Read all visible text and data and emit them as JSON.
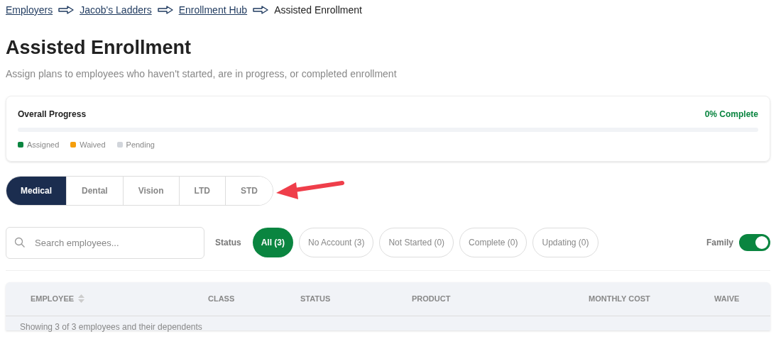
{
  "breadcrumbs": [
    {
      "label": "Employers",
      "link": true
    },
    {
      "label": "Jacob's Ladders",
      "link": true
    },
    {
      "label": "Enrollment Hub",
      "link": true
    },
    {
      "label": "Assisted Enrollment",
      "link": false
    }
  ],
  "title": "Assisted Enrollment",
  "subtitle": "Assign plans to employees who haven't started, are in progress, or completed enrollment",
  "progress": {
    "title": "Overall Progress",
    "reading": "0% Complete",
    "level": 0,
    "legend": [
      {
        "label": "Assigned",
        "color": "#0a8540"
      },
      {
        "label": "Waived",
        "color": "#f59e0b"
      },
      {
        "label": "Pending",
        "color": "#d1d5db"
      }
    ]
  },
  "tabs": [
    {
      "label": "Medical",
      "selected": true
    },
    {
      "label": "Dental",
      "selected": false
    },
    {
      "label": "Vision",
      "selected": false
    },
    {
      "label": "LTD",
      "selected": false
    },
    {
      "label": "STD",
      "selected": false
    }
  ],
  "search": {
    "placeholder": "Search employees..."
  },
  "status_label": "Status",
  "filters": [
    {
      "label": "All (3)",
      "selected": true
    },
    {
      "label": "No Account (3)",
      "selected": false
    },
    {
      "label": "Not Started (0)",
      "selected": false
    },
    {
      "label": "Complete (0)",
      "selected": false
    },
    {
      "label": "Updating (0)",
      "selected": false
    }
  ],
  "family_toggle": {
    "label": "Family",
    "on": true
  },
  "table": {
    "columns": [
      {
        "label": "EMPLOYEE",
        "sortable": true
      },
      {
        "label": "CLASS",
        "sortable": false
      },
      {
        "label": "STATUS",
        "sortable": false
      },
      {
        "label": "PRODUCT",
        "sortable": false
      },
      {
        "label": "MONTHLY COST",
        "sortable": false
      },
      {
        "label": "WAIVE",
        "sortable": false
      }
    ],
    "summary": "Showing 3 of 3 employees and their dependents"
  }
}
